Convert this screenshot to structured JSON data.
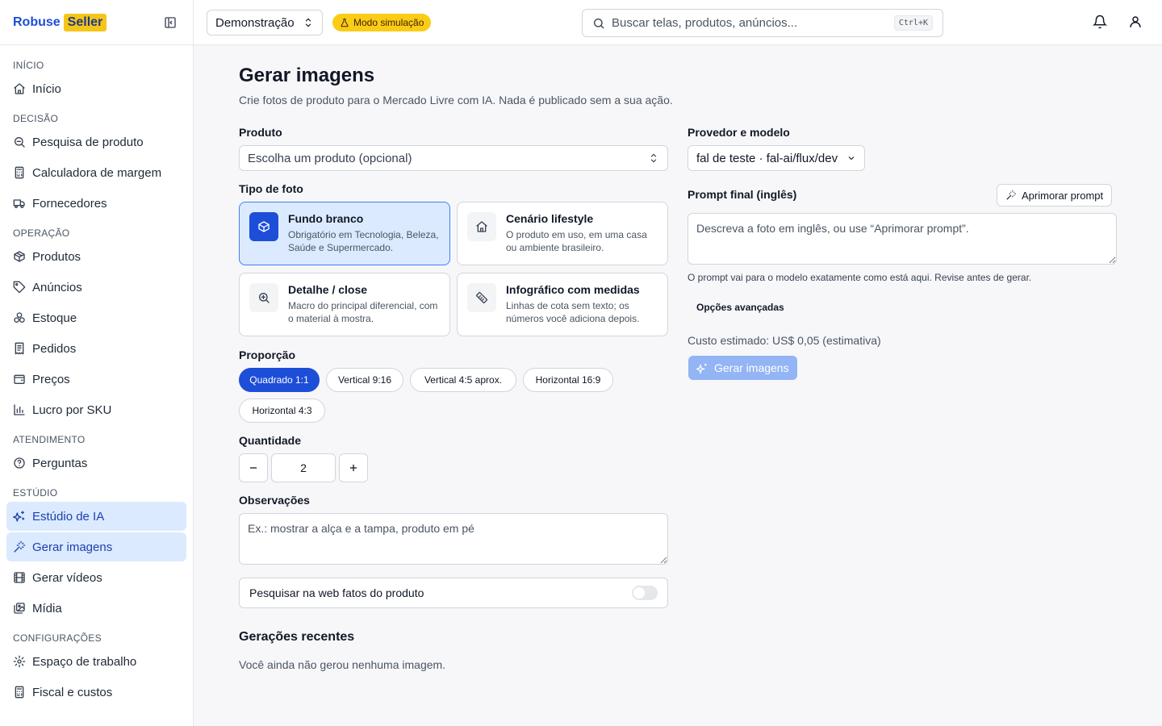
{
  "brand": {
    "name_part1": "Robuse",
    "name_part2": "Seller"
  },
  "sidebar": {
    "sections": [
      {
        "title": "INÍCIO",
        "items": [
          {
            "label": "Início",
            "icon": "home-icon"
          }
        ]
      },
      {
        "title": "DECISÃO",
        "items": [
          {
            "label": "Pesquisa de produto",
            "icon": "search-zoom-icon"
          },
          {
            "label": "Calculadora de margem",
            "icon": "calculator-icon"
          },
          {
            "label": "Fornecedores",
            "icon": "truck-icon"
          }
        ]
      },
      {
        "title": "OPERAÇÃO",
        "items": [
          {
            "label": "Produtos",
            "icon": "package-icon"
          },
          {
            "label": "Anúncios",
            "icon": "tag-icon"
          },
          {
            "label": "Estoque",
            "icon": "boxes-icon"
          },
          {
            "label": "Pedidos",
            "icon": "receipt-icon"
          },
          {
            "label": "Preços",
            "icon": "wallet-icon"
          },
          {
            "label": "Lucro por SKU",
            "icon": "bar-chart-icon"
          }
        ]
      },
      {
        "title": "ATENDIMENTO",
        "items": [
          {
            "label": "Perguntas",
            "icon": "help-circle-icon"
          }
        ]
      },
      {
        "title": "ESTÚDIO",
        "items": [
          {
            "label": "Estúdio de IA",
            "icon": "sparkles-icon",
            "active": true
          },
          {
            "label": "Gerar imagens",
            "icon": "magic-wand-icon",
            "active": true
          },
          {
            "label": "Gerar vídeos",
            "icon": "film-icon"
          },
          {
            "label": "Mídia",
            "icon": "images-icon"
          }
        ]
      },
      {
        "title": "CONFIGURAÇÕES",
        "items": [
          {
            "label": "Espaço de trabalho",
            "icon": "gear-icon"
          },
          {
            "label": "Fiscal e custos",
            "icon": "calculator-icon"
          }
        ]
      }
    ]
  },
  "topbar": {
    "workspace": "Demonstração",
    "sim_badge": "Modo simulação",
    "search_placeholder": "Buscar telas, produtos, anúncios...",
    "search_shortcut": "Ctrl+K"
  },
  "page": {
    "title": "Gerar imagens",
    "subtitle": "Crie fotos de produto para o Mercado Livre com IA. Nada é publicado sem a sua ação."
  },
  "form": {
    "product_label": "Produto",
    "product_placeholder": "Escolha um produto (opcional)",
    "photo_type_label": "Tipo de foto",
    "photo_types": [
      {
        "title": "Fundo branco",
        "desc": "Obrigatório em Tecnologia, Beleza, Saúde e Supermercado.",
        "icon": "box-icon",
        "selected": true
      },
      {
        "title": "Cenário lifestyle",
        "desc": "O produto em uso, em uma casa ou ambiente brasileiro.",
        "icon": "house-icon",
        "selected": false
      },
      {
        "title": "Detalhe / close",
        "desc": "Macro do principal diferencial, com o material à mostra.",
        "icon": "zoom-in-icon",
        "selected": false
      },
      {
        "title": "Infográfico com medidas",
        "desc": "Linhas de cota sem texto; os números você adiciona depois.",
        "icon": "ruler-icon",
        "selected": false
      }
    ],
    "ratio_label": "Proporção",
    "ratios": [
      {
        "label": "Quadrado 1:1",
        "selected": true
      },
      {
        "label": "Vertical 9:16",
        "selected": false
      },
      {
        "label": "Vertical 4:5 aprox.",
        "selected": false
      },
      {
        "label": "Horizontal 16:9",
        "selected": false
      },
      {
        "label": "Horizontal 4:3",
        "selected": false
      }
    ],
    "quantity_label": "Quantidade",
    "quantity_value": "2",
    "notes_label": "Observações",
    "notes_placeholder": "Ex.: mostrar a alça e a tampa, produto em pé",
    "web_search_label": "Pesquisar na web fatos do produto",
    "web_search_on": false
  },
  "right": {
    "provider_label": "Provedor e modelo",
    "provider_value": "fal de teste · fal-ai/flux/dev",
    "prompt_label": "Prompt final (inglês)",
    "improve_button": "Aprimorar prompt",
    "prompt_placeholder": "Descreva a foto em inglês, ou use “Aprimorar prompt”.",
    "prompt_hint": "O prompt vai para o modelo exatamente como está aqui. Revise antes de gerar.",
    "advanced_options": "Opções avançadas",
    "cost": "Custo estimado: US$ 0,05 (estimativa)",
    "generate_button": "Gerar imagens"
  },
  "recent": {
    "title": "Gerações recentes",
    "empty": "Você ainda não gerou nenhuma imagem."
  },
  "colors": {
    "primary": "#1d4ed8",
    "active_bg": "#dbeafe",
    "badge": "#facc15",
    "disabled_btn": "#93b4f5"
  }
}
